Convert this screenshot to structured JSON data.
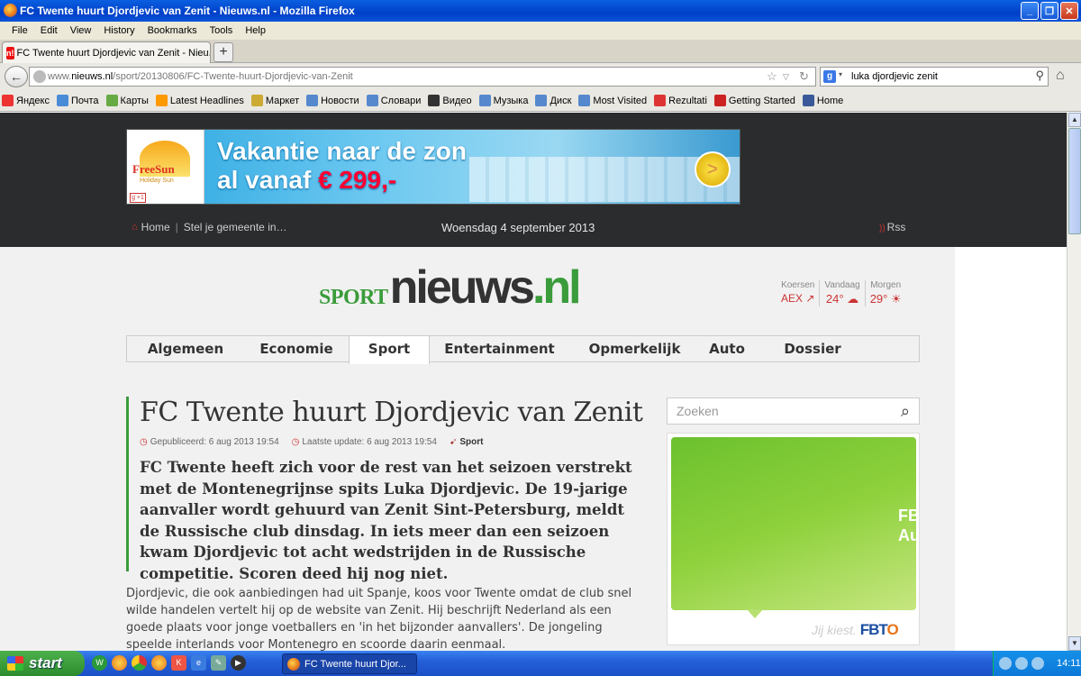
{
  "window": {
    "title": "FC Twente huurt Djordjevic van Zenit - Nieuws.nl - Mozilla Firefox"
  },
  "menu": [
    "File",
    "Edit",
    "View",
    "History",
    "Bookmarks",
    "Tools",
    "Help"
  ],
  "tab": {
    "label": "FC Twente huurt Djordjevic van Zenit - Nieu...",
    "favicon": "n!"
  },
  "url": {
    "prefix": "www.",
    "host": "nieuws.nl",
    "path": "/sport/20130806/FC-Twente-huurt-Djordjevic-van-Zenit"
  },
  "search": {
    "value": "luka djordjevic zenit",
    "engine_icon": "g"
  },
  "bookmarks": [
    {
      "label": "Яндекс",
      "color": "#e33"
    },
    {
      "label": "Почта",
      "color": "#4a8bd8"
    },
    {
      "label": "Карты",
      "color": "#6a4"
    },
    {
      "label": "Latest Headlines",
      "color": "#f90"
    },
    {
      "label": "Маркет",
      "color": "#ca3"
    },
    {
      "label": "Новости",
      "color": "#58c"
    },
    {
      "label": "Словари",
      "color": "#58c"
    },
    {
      "label": "Видео",
      "color": "#333"
    },
    {
      "label": "Музыка",
      "color": "#58c"
    },
    {
      "label": "Диск",
      "color": "#58c"
    },
    {
      "label": "Most Visited",
      "color": "#58c"
    },
    {
      "label": "Rezultati",
      "color": "#d33"
    },
    {
      "label": "Getting Started",
      "color": "#c22"
    },
    {
      "label": "Home",
      "color": "#3b5998"
    }
  ],
  "banner": {
    "brand": "FreeSun",
    "brand_sub": "Holiday Sun",
    "gplus": "g +1",
    "line1": "Vakantie naar de zon",
    "line2_prefix": "al vanaf ",
    "line2_price": "€ 299,-",
    "arrow": ">"
  },
  "topnav": {
    "home": "Home",
    "region": "Stel je gemeente in…",
    "date": "Woensdag 4 september 2013",
    "rss": "Rss"
  },
  "logo": {
    "sport": "SPORT",
    "nieuws": "nieuws",
    "nl": ".nl"
  },
  "weather": [
    {
      "label": "Koersen",
      "value": "AEX ↗"
    },
    {
      "label": "Vandaag",
      "value": "24° ☁"
    },
    {
      "label": "Morgen",
      "value": "29° ☀"
    }
  ],
  "categories": [
    "Algemeen",
    "Economie",
    "Sport",
    "Entertainment",
    "Opmerkelijk",
    "Auto",
    "Dossier"
  ],
  "active_category": "Sport",
  "article": {
    "title": "FC Twente huurt Djordjevic van Zenit",
    "published": "Gepubliceerd: 6 aug 2013 19:54",
    "updated": "Laatste update: 6 aug 2013 19:54",
    "section": "Sport",
    "lead": "FC Twente heeft zich voor de rest van het seizoen verstrekt met de Montenegrijnse spits Luka Djordjevic. De 19-jarige aanvaller wordt gehuurd van Zenit Sint-Petersburg, meldt de Russische club dinsdag. In iets meer dan een seizoen kwam Djordjevic tot acht wedstrijden in de Russische competitie. Scoren deed hij nog niet.",
    "body": "Djordjevic, die ook aanbiedingen had uit Spanje, koos voor Twente omdat de club snel wilde handelen vertelt hij op de website van Zenit. Hij beschrijft Nederland als een goede plaats voor jonge voetballers en 'in het bijzonder aanvallers'. De jongeling speelde interlands voor Montenegro en scoorde daarin eenmaal."
  },
  "sidebar": {
    "search_placeholder": "Zoeken",
    "ad_text": "FB\nAu",
    "ad_footer": "Jij kiest.",
    "ad_brand_a": "FBT",
    "ad_brand_b": "O"
  },
  "taskbar": {
    "start": "start",
    "task": "FC Twente huurt Djor...",
    "clock": "14:11"
  }
}
